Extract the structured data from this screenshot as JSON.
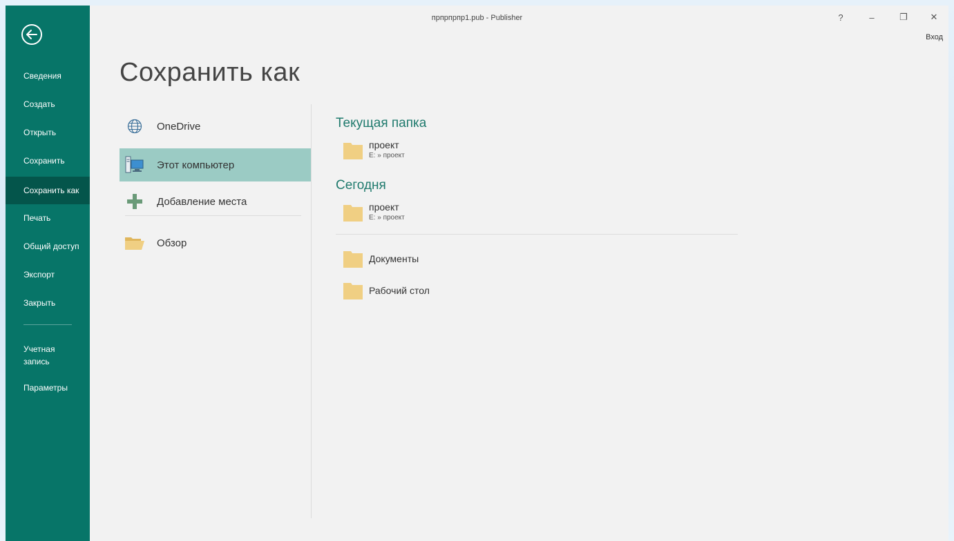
{
  "window": {
    "title": "прпрпрпр1.pub - Publisher",
    "help_label": "?",
    "minimize_label": "–",
    "restore_label": "❐",
    "close_label": "✕",
    "signin_label": "Вход"
  },
  "sidebar": {
    "items": [
      {
        "label": "Сведения"
      },
      {
        "label": "Создать"
      },
      {
        "label": "Открыть"
      },
      {
        "label": "Сохранить"
      },
      {
        "label": "Сохранить как"
      },
      {
        "label": "Печать"
      },
      {
        "label": "Общий доступ"
      },
      {
        "label": "Экспорт"
      },
      {
        "label": "Закрыть"
      },
      {
        "label": "Учетная запись"
      },
      {
        "label": "Параметры"
      }
    ],
    "active_index": 4,
    "accent": "#077568"
  },
  "page": {
    "title": "Сохранить как"
  },
  "places": [
    {
      "label": "OneDrive",
      "icon": "globe-icon"
    },
    {
      "label": "Этот компьютер",
      "icon": "computer-icon",
      "selected": true
    },
    {
      "label": "Добавление места",
      "icon": "plus-icon"
    },
    {
      "label": "Обзор",
      "icon": "folder-open-icon"
    }
  ],
  "current_folder": {
    "heading": "Текущая папка",
    "items": [
      {
        "name": "проект",
        "path": "E: » проект"
      }
    ]
  },
  "today": {
    "heading": "Сегодня",
    "items": [
      {
        "name": "проект",
        "path": "E: » проект"
      }
    ]
  },
  "other_folders": [
    {
      "name": "Документы"
    },
    {
      "name": "Рабочий стол"
    }
  ],
  "colors": {
    "selected_place": "#9bcbc4",
    "heading": "#1f7a6d",
    "folder": "#f0cf83"
  }
}
